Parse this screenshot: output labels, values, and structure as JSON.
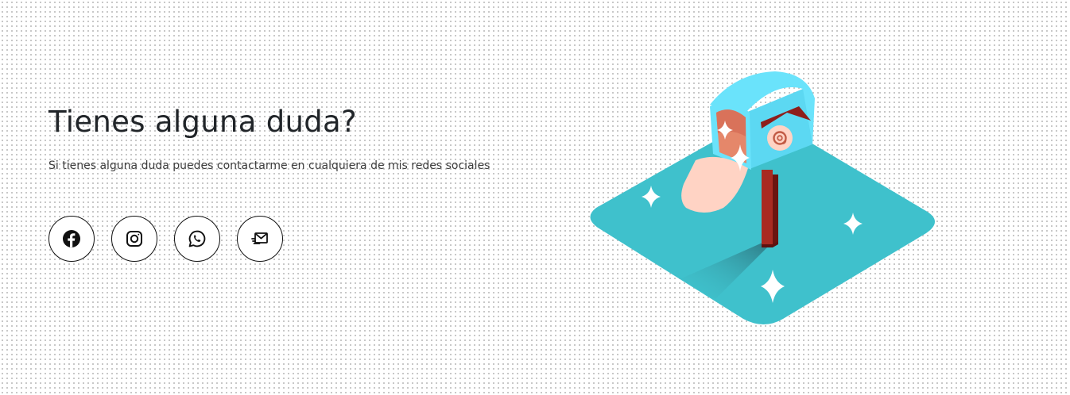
{
  "contact": {
    "title": "Tienes alguna duda?",
    "subtitle": "Si tienes alguna duda puedes contactarme en cualquiera de mis redes sociales"
  },
  "social_links": [
    {
      "name": "Facebook",
      "icon": "facebook-icon"
    },
    {
      "name": "Instagram",
      "icon": "instagram-icon"
    },
    {
      "name": "WhatsApp",
      "icon": "whatsapp-icon"
    },
    {
      "name": "Email",
      "icon": "email-icon"
    }
  ],
  "illustration": {
    "symbol": "@",
    "colors": {
      "ground": "#3fc1cc",
      "mailbox": "#6ae3fb",
      "post": "#8e1e1b",
      "inner": "#e5876a",
      "flag": "#ffd3c4"
    }
  }
}
